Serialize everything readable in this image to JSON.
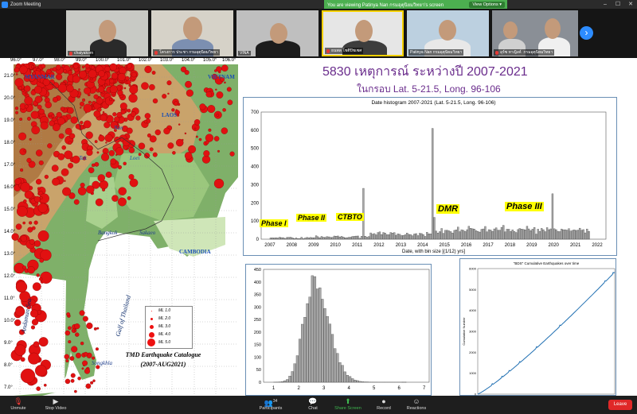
{
  "window": {
    "title": "Zoom Meeting"
  },
  "share_banner": {
    "text": "You are viewing Patinya Nan กรมอุตุนิยมวิทยา's screen",
    "view_options": "View Options"
  },
  "participants": [
    {
      "name": "chaiyakorn",
      "muted": true
    },
    {
      "name": "โครงการ ประชา กรมอุตุนิยมวิทยา",
      "muted": true
    },
    {
      "name": "VINA",
      "muted": false
    },
    {
      "name": "ธนพล โชติปิชเซศ",
      "muted": true
    },
    {
      "name": "Patinya Nan กรมอุตุนิยมวิทยา",
      "muted": false
    },
    {
      "name": "อุร์ซ หาญิงค์",
      "muted": true
    },
    {
      "name": "กรมอุตุนิยมวิทยา",
      "muted": false
    }
  ],
  "map": {
    "lon_labels": [
      "96.0°",
      "97.0°",
      "98.0°",
      "99.0°",
      "100.0°",
      "101.0°",
      "102.0°",
      "103.0°",
      "104.0°",
      "105.0°",
      "106.0°"
    ],
    "lat_labels": [
      "21.0°",
      "20.0°",
      "19.0°",
      "18.0°",
      "17.0°",
      "16.0°",
      "15.0°",
      "14.0°",
      "13.0°",
      "12.0°",
      "11.0°",
      "10.0°",
      "9.0°",
      "8.0°",
      "7.0°",
      "6.0°"
    ],
    "place_labels": [
      "MYANMAR",
      "VIETNAM",
      "LAOS",
      "Nan",
      "Tak",
      "Loei",
      "Bangkok",
      "Sakaeo",
      "CAMBODIA",
      "Andaman Sea",
      "Gulf of Thailand",
      "Songkhla"
    ],
    "legend": [
      "ML 1.0",
      "ML 2.0",
      "ML 3.0",
      "ML 4.0",
      "ML 5.0"
    ],
    "caption_line1": "TMD Earthquake Catalogue",
    "caption_line2": "(2007-AUG2021)"
  },
  "slide": {
    "title": "5830 เหตุการณ์ ระหว่างปี 2007-2021",
    "subtitle": "ในกรอบ Lat. 5-21.5, Long. 96-106",
    "phases": [
      "Phase I",
      "Phase II",
      "CTBTO",
      "DMR",
      "Phase III"
    ]
  },
  "chart_data": [
    {
      "type": "bar",
      "title": "Date histogram 2007-2021 (Lat. 5-21.5, Long. 96-106)",
      "xlabel": "Date, with bin size [(1/12) yrs]",
      "x_ticks": [
        "2007",
        "2008",
        "2009",
        "2010",
        "2011",
        "2012",
        "2013",
        "2014",
        "2015",
        "2016",
        "2017",
        "2018",
        "2019",
        "2020",
        "2021",
        "2022"
      ],
      "y_ticks": [
        "0",
        "100",
        "200",
        "300",
        "400",
        "500",
        "600",
        "700"
      ],
      "xlim": [
        2006.6,
        2022.4
      ],
      "ylim": [
        0,
        700
      ],
      "peaks": [
        {
          "x": 2011.25,
          "y": 280
        },
        {
          "x": 2014.38,
          "y": 610
        },
        {
          "x": 2019.9,
          "y": 250
        }
      ]
    },
    {
      "type": "bar",
      "title": "",
      "x_ticks": [
        "1",
        "2",
        "3",
        "4",
        "5",
        "6",
        "7"
      ],
      "y_ticks": [
        "0",
        "50",
        "100",
        "150",
        "200",
        "250",
        "300",
        "350",
        "400",
        "450"
      ],
      "xlim": [
        0.6,
        7.2
      ],
      "ylim": [
        0,
        450
      ],
      "peak": {
        "x": 2.5,
        "y": 425
      }
    },
    {
      "type": "line",
      "title": "\"BDS\" Cumulative Earthquakes over time",
      "ylabel": "Cumulative Number",
      "y_ticks": [
        "0",
        "1000",
        "2000",
        "3000",
        "4000",
        "5000",
        "6000"
      ],
      "ylim": [
        0,
        6000
      ],
      "end_value": 5830
    }
  ],
  "toolbar": {
    "unmute": "Unmute",
    "stop_video": "Stop Video",
    "participants": "Participants",
    "participants_count": "34",
    "chat": "Chat",
    "share": "Share Screen",
    "record": "Record",
    "reactions": "Reactions",
    "leave": "Leave"
  },
  "colors": {
    "zoom_blue": "#2d8cff",
    "share_green": "#4caf50",
    "leave_red": "#e02828",
    "title_purple": "#6a2c8c",
    "quake_red": "#e11111"
  }
}
